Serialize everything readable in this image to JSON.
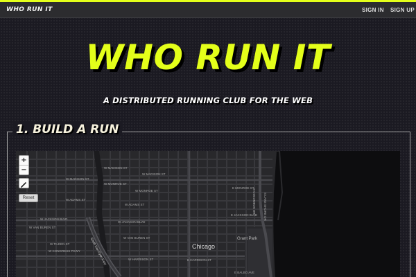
{
  "nav": {
    "brand": "WHO RUN IT",
    "sign_in": "SIGN IN",
    "sign_up": "SIGN UP"
  },
  "hero": {
    "title": "WHO RUN IT",
    "subtitle": "A DISTRIBUTED RUNNING CLUB FOR THE WEB"
  },
  "section": {
    "title": "1. BUILD A RUN"
  },
  "map": {
    "zoom_in": "+",
    "zoom_out": "−",
    "reset": "Reset",
    "city": "Chicago",
    "park": "Grant Park",
    "highway": "South Dan Ryan Expy",
    "streets": {
      "madison_1": "W MADISON ST",
      "madison_2": "W MADISON ST",
      "madison_3": "W MADISON ST",
      "monroe_1": "W MONROE ST",
      "monroe_2": "E MONROE ST",
      "monroe_3": "W MONROE ST",
      "adams_1": "W ADAMS ST",
      "adams_2": "W ADAMS ST",
      "jackson_1": "W JACKSON BLVD",
      "jackson_2": "W JACKSON BLVD",
      "jackson_3": "E JACKSON BLVD",
      "vanburen_1": "W VAN BUREN ST",
      "vanburen_2": "W VAN BUREN ST",
      "tilden": "W TILDEN ST",
      "congress": "W CONGRESS PKWY",
      "harrison_1": "W HARRISON ST",
      "harrison_2": "E HARRISON ST",
      "balbo": "E BALBO AVE",
      "columbus": "S COLUMBUS DR",
      "lakeshore": "S LAKE SHORE DR"
    },
    "colors": {
      "background": "#28282b",
      "street": "#3c3c40",
      "water": "#0d0d0f"
    }
  },
  "colors": {
    "accent": "#e4ff1a",
    "page_bg": "#1b1a22",
    "nav_bg": "#2c2c2f"
  }
}
